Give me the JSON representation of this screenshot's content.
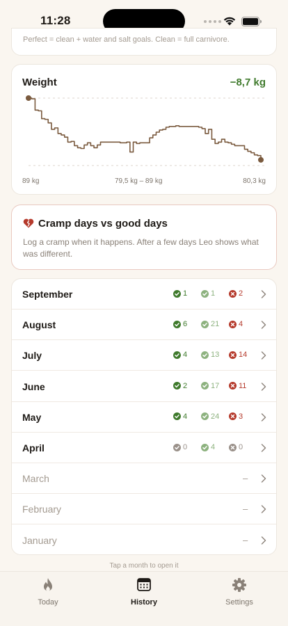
{
  "status_bar": {
    "time": "11:28"
  },
  "top_card": {
    "text": "Perfect = clean + water and salt goals. Clean = full carnivore."
  },
  "weight": {
    "title": "Weight",
    "delta": "−8,7 kg",
    "axis_start": "89 kg",
    "axis_range": "79,5 kg – 89 kg",
    "axis_end": "80,3 kg",
    "line_color": "#7a5a3e",
    "delta_color": "#3f7a2c",
    "chart_data": {
      "type": "line",
      "ylim": [
        79.5,
        89
      ],
      "y_start": 89,
      "y_end": 80.3,
      "values": [
        89,
        88.9,
        87.3,
        87.2,
        86.1,
        86.0,
        85.5,
        84.6,
        84.8,
        84.0,
        83.8,
        83.5,
        82.8,
        82.9,
        82.3,
        82.0,
        81.9,
        82.4,
        82.7,
        82.3,
        82.0,
        82.4,
        82.8,
        82.8,
        82.8,
        82.8,
        82.8,
        82.8,
        82.7,
        82.7,
        82.8,
        81.4,
        82.8,
        82.6,
        82.7,
        82.7,
        82.7,
        83.4,
        83.8,
        84.2,
        84.5,
        84.6,
        84.9,
        85.0,
        85.0,
        85.1,
        85.0,
        85.0,
        85.0,
        85.0,
        85.0,
        85.0,
        84.9,
        84.7,
        84.0,
        84.6,
        83.2,
        82.6,
        82.8,
        83.2,
        82.8,
        82.7,
        82.5,
        82.3,
        82.3,
        82.3,
        81.8,
        81.5,
        81.3,
        81.0,
        80.9,
        80.3
      ]
    }
  },
  "cramp": {
    "title": "Cramp days vs good days",
    "description": "Log a cramp when it happens. After a few days Leo shows what was different."
  },
  "months": [
    {
      "name": "September",
      "active": true,
      "clean": "1",
      "partial": "1",
      "cramps": "2",
      "dash": ""
    },
    {
      "name": "August",
      "active": true,
      "clean": "6",
      "partial": "21",
      "cramps": "4",
      "dash": ""
    },
    {
      "name": "July",
      "active": true,
      "clean": "4",
      "partial": "13",
      "cramps": "14",
      "dash": ""
    },
    {
      "name": "June",
      "active": true,
      "clean": "2",
      "partial": "17",
      "cramps": "11",
      "dash": ""
    },
    {
      "name": "May",
      "active": true,
      "clean": "4",
      "partial": "24",
      "cramps": "3",
      "dash": ""
    },
    {
      "name": "April",
      "active": true,
      "gray": true,
      "clean": "0",
      "partial": "4",
      "cramps": "0",
      "dash": ""
    },
    {
      "name": "March",
      "active": false,
      "dash": "–"
    },
    {
      "name": "February",
      "active": false,
      "dash": "–"
    },
    {
      "name": "January",
      "active": false,
      "dash": "–"
    }
  ],
  "hint": "Tap a month to open it",
  "tabs": [
    {
      "label": "Today",
      "icon": "flame-icon"
    },
    {
      "label": "History",
      "icon": "calendar-icon",
      "active": true
    },
    {
      "label": "Settings",
      "icon": "gear-icon"
    }
  ],
  "colors": {
    "accent_green": "#3f7a2c",
    "light_green": "#8db27f",
    "red": "#b53a2c",
    "background": "#faf6f0"
  }
}
